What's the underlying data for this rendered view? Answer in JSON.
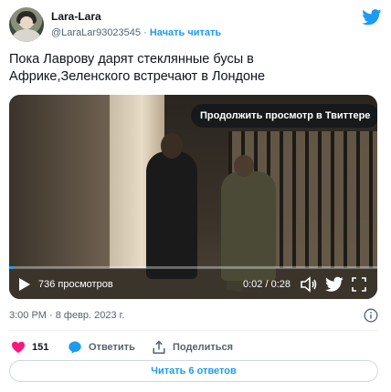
{
  "author": {
    "name": "Lara-Lara",
    "handle": "@LaraLar93023545",
    "separator": "·",
    "follow_label": "Начать читать"
  },
  "tweet": {
    "text": "Пока Лаврову дарят стеклянные бусы в Африке,Зеленского встречают в Лондоне"
  },
  "video": {
    "continue_label": "Продолжить просмотр в Твиттере",
    "views_label": "736 просмотров",
    "time_label": "0:02 / 0:28",
    "progress": 0.0125
  },
  "meta": {
    "timestamp": "3:00 PM · 8 февр. 2023 г."
  },
  "actions": {
    "like_count": "151",
    "reply_label": "Ответить",
    "share_label": "Поделиться"
  },
  "footer": {
    "read_replies_label": "Читать 6 ответов"
  },
  "colors": {
    "accent": "#1d9bf0",
    "like": "#f91880",
    "text": "#0f1419",
    "muted": "#536471"
  },
  "icons": [
    "twitter-bird-icon",
    "play-icon",
    "volume-icon",
    "gif-icon",
    "fullscreen-icon",
    "info-icon",
    "heart-icon",
    "reply-icon",
    "share-icon"
  ]
}
